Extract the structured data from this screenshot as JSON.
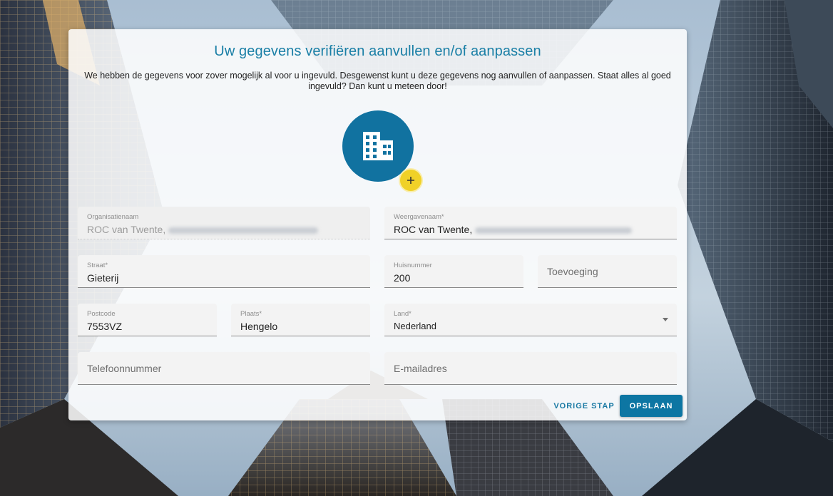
{
  "page": {
    "title": "Uw gegevens verifiëren aanvullen en/of aanpassen",
    "intro": "We hebben de gegevens voor zover mogelijk al voor u ingevuld. Desgewenst kunt u deze gegevens nog aanvullen of aanpassen. Staat alles al goed ingevuld? Dan kunt u meteen door!"
  },
  "avatar": {
    "icon": "building-icon",
    "badge_icon": "plus-icon",
    "color": "#1172a0",
    "badge_color": "#f0d128"
  },
  "form": {
    "organisatienaam": {
      "label": "Organisatienaam",
      "value": "ROC van Twente,"
    },
    "weergavenaam": {
      "label": "Weergavenaam*",
      "value": "ROC van Twente,"
    },
    "straat": {
      "label": "Straat*",
      "value": "Gieterij"
    },
    "huisnummer": {
      "label": "Huisnummer",
      "value": "200"
    },
    "toevoeging": {
      "placeholder": "Toevoeging"
    },
    "postcode": {
      "label": "Postcode",
      "value": "7553VZ"
    },
    "plaats": {
      "label": "Plaats*",
      "value": "Hengelo"
    },
    "land": {
      "label": "Land*",
      "value": "Nederland"
    },
    "telefoonnummer": {
      "placeholder": "Telefoonnummer"
    },
    "emailadres": {
      "placeholder": "E-mailadres"
    }
  },
  "actions": {
    "previous_label": "VORIGE STAP",
    "save_label": "OPSLAAN",
    "accent_color": "#0d76a3"
  }
}
